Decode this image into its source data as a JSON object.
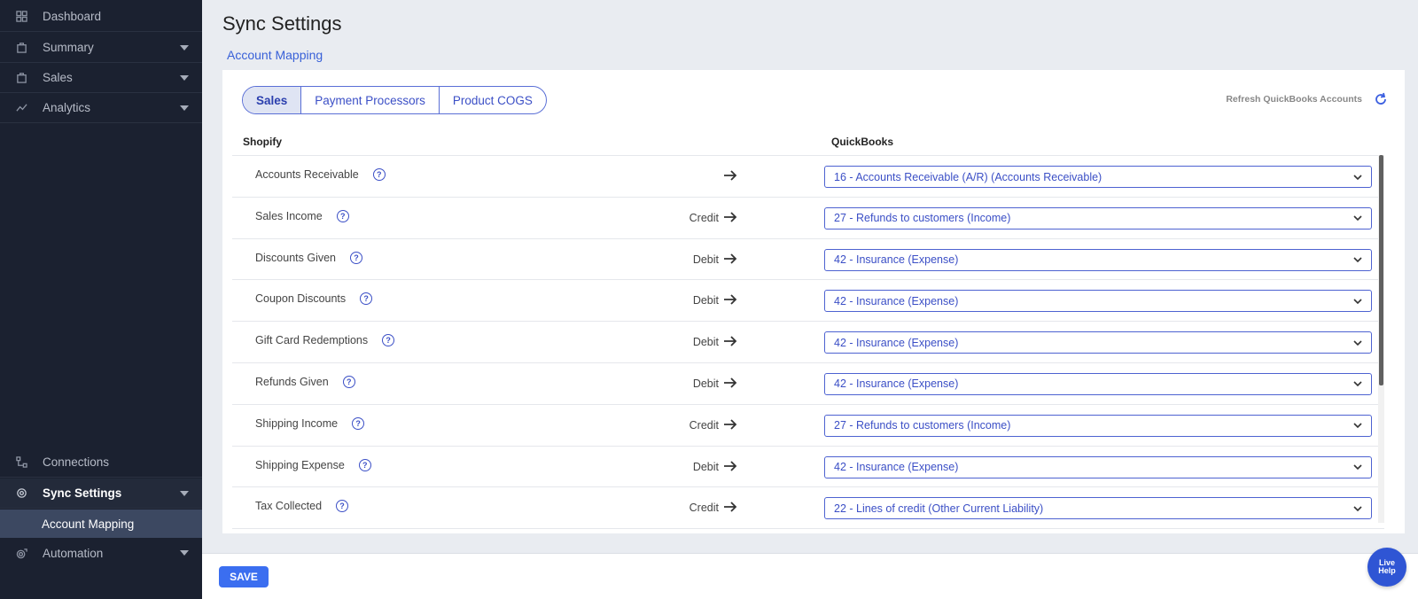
{
  "sidebar": {
    "items": [
      {
        "label": "Dashboard",
        "icon": "grid-icon"
      },
      {
        "label": "Summary",
        "icon": "bag-icon"
      },
      {
        "label": "Sales",
        "icon": "bag-icon"
      },
      {
        "label": "Analytics",
        "icon": "trend-icon"
      },
      {
        "label": "Connections",
        "icon": "connections-icon"
      },
      {
        "label": "Sync Settings",
        "icon": "gear-icon"
      },
      {
        "label": "Automation",
        "icon": "gear-icon"
      }
    ],
    "sub_item": "Account Mapping"
  },
  "main": {
    "title": "Sync Settings",
    "section": "Account Mapping",
    "tabs": [
      "Sales",
      "Payment Processors",
      "Product COGS"
    ],
    "active_tab": "Sales",
    "refresh_label": "Refresh QuickBooks Accounts",
    "col_shopify": "Shopify",
    "col_quickbooks": "QuickBooks",
    "rows": [
      {
        "name": "Accounts Receivable",
        "dir": "",
        "account": "16 - Accounts Receivable (A/R) (Accounts Receivable)"
      },
      {
        "name": "Sales Income",
        "dir": "Credit",
        "account": "27 - Refunds to customers (Income)"
      },
      {
        "name": "Discounts Given",
        "dir": "Debit",
        "account": "42 - Insurance (Expense)"
      },
      {
        "name": "Coupon Discounts",
        "dir": "Debit",
        "account": "42 - Insurance (Expense)"
      },
      {
        "name": "Gift Card Redemptions",
        "dir": "Debit",
        "account": "42 - Insurance (Expense)"
      },
      {
        "name": "Refunds Given",
        "dir": "Debit",
        "account": "42 - Insurance (Expense)"
      },
      {
        "name": "Shipping Income",
        "dir": "Credit",
        "account": "27 - Refunds to customers (Income)"
      },
      {
        "name": "Shipping Expense",
        "dir": "Debit",
        "account": "42 - Insurance (Expense)"
      },
      {
        "name": "Tax Collected",
        "dir": "Credit",
        "account": "22 - Lines of credit (Other Current Liability)"
      }
    ]
  },
  "footer": {
    "save_label": "SAVE"
  },
  "live_help": {
    "line1": "Live",
    "line2": "Help"
  },
  "colors": {
    "sidebar_bg": "#1b2130",
    "accent": "#3b4fc6",
    "save_button": "#3b6ef0"
  }
}
